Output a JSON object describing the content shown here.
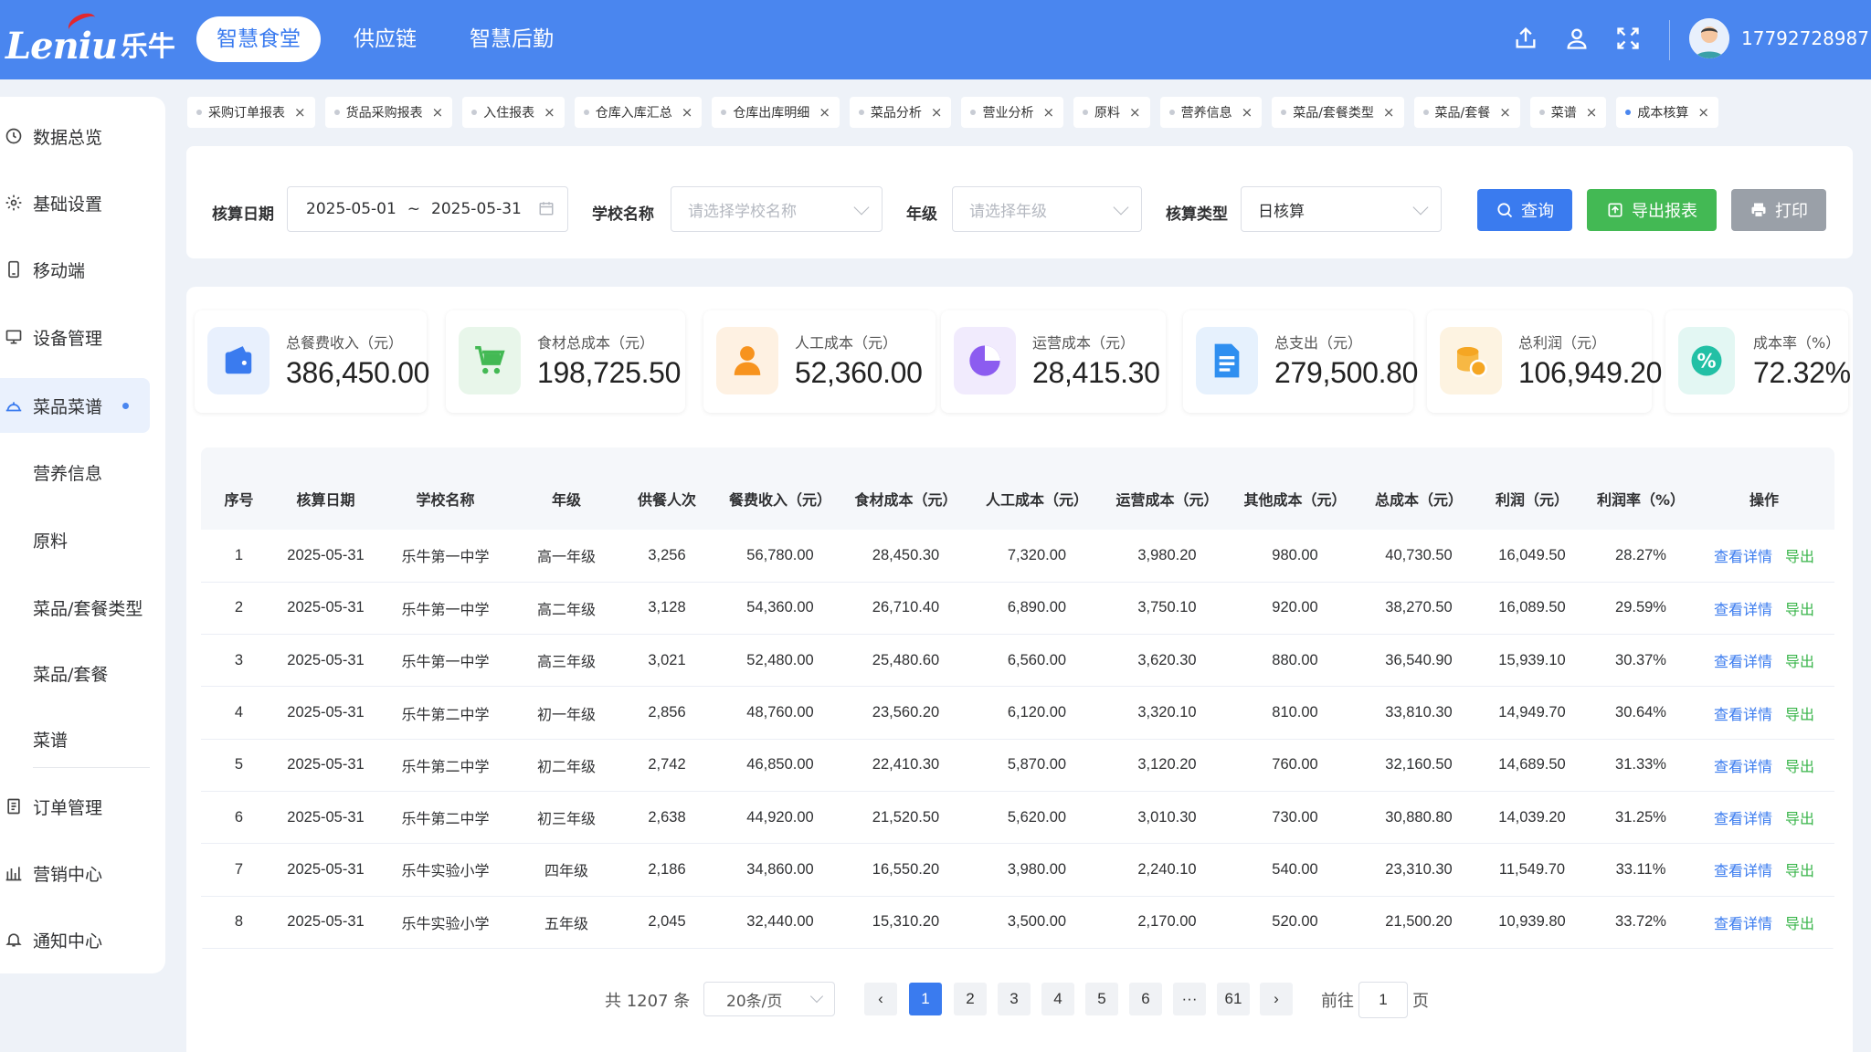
{
  "brand": {
    "en": "Leniu",
    "cn": "乐牛"
  },
  "nav": [
    {
      "label": "智慧食堂",
      "active": true
    },
    {
      "label": "供应链",
      "active": false
    },
    {
      "label": "智慧后勤",
      "active": false
    }
  ],
  "header_icons": [
    "share-icon",
    "user-icon",
    "fullscreen-icon"
  ],
  "user": {
    "phone": "17792728987"
  },
  "sidebar": [
    {
      "label": "数据总览",
      "icon": "clock-icon"
    },
    {
      "label": "基础设置",
      "icon": "gear-icon"
    },
    {
      "label": "移动端",
      "icon": "mobile-icon"
    },
    {
      "label": "设备管理",
      "icon": "monitor-icon"
    },
    {
      "label": "菜品菜谱",
      "icon": "dish-icon",
      "active": true
    },
    {
      "label": "营养信息",
      "sub": true
    },
    {
      "label": "原料",
      "sub": true
    },
    {
      "label": "菜品/套餐类型",
      "sub": true
    },
    {
      "label": "菜品/套餐",
      "sub": true
    },
    {
      "label": "菜谱",
      "sub": true
    },
    {
      "label": "订单管理",
      "icon": "order-icon"
    },
    {
      "label": "营销中心",
      "icon": "bar-chart-icon"
    },
    {
      "label": "通知中心",
      "icon": "bell-icon"
    }
  ],
  "tabs": [
    "采购订单报表",
    "货品采购报表",
    "入住报表",
    "仓库入库汇总",
    "仓库出库明细",
    "菜品分析",
    "营业分析",
    "原料",
    "营养信息",
    "菜品/套餐类型",
    "菜品/套餐",
    "菜谱",
    "成本核算"
  ],
  "active_tab": "成本核算",
  "filters": {
    "date_label": "核算日期",
    "date_start": "2025-05-01",
    "date_sep": "~",
    "date_end": "2025-05-31",
    "school_label": "学校名称",
    "school_placeholder": "请选择学校名称",
    "grade_label": "年级",
    "grade_placeholder": "请选择年级",
    "type_label": "核算类型",
    "type_value": "日核算",
    "query_btn": "查询",
    "export_btn": "导出报表",
    "print_btn": "打印"
  },
  "colors": {
    "primary": "#3a7bef",
    "success": "#43b954",
    "gray": "#9aa0a8",
    "header": "#4a86ef"
  },
  "stats": [
    {
      "label": "总餐费收入（元）",
      "value": "386,450.00",
      "icon": "wallet-icon",
      "color": "#3a7bef"
    },
    {
      "label": "食材总成本（元）",
      "value": "198,725.50",
      "icon": "cart-icon",
      "color": "#43b954"
    },
    {
      "label": "人工成本（元）",
      "value": "52,360.00",
      "icon": "person-icon",
      "color": "#f7931e"
    },
    {
      "label": "运营成本（元）",
      "value": "28,415.30",
      "icon": "pie-icon",
      "color": "#8c5cf0"
    },
    {
      "label": "总支出（元）",
      "value": "279,500.80",
      "icon": "document-icon",
      "color": "#2f8ff0"
    },
    {
      "label": "总利润（元）",
      "value": "106,949.20",
      "icon": "coins-icon",
      "color": "#f5a623"
    },
    {
      "label": "成本率（%）",
      "value": "72.32%",
      "icon": "percent-icon",
      "color": "#22c0a5"
    }
  ],
  "table": {
    "columns": [
      "序号",
      "核算日期",
      "学校名称",
      "年级",
      "供餐人次",
      "餐费收入（元）",
      "食材成本（元）",
      "人工成本（元）",
      "运营成本（元）",
      "其他成本（元）",
      "总成本（元）",
      "利润（元）",
      "利润率（%）",
      "操作"
    ],
    "view_label": "查看详情",
    "export_label": "导出",
    "rows": [
      [
        "1",
        "2025-05-31",
        "乐牛第一中学",
        "高一年级",
        "3,256",
        "56,780.00",
        "28,450.30",
        "7,320.00",
        "3,980.20",
        "980.00",
        "40,730.50",
        "16,049.50",
        "28.27%"
      ],
      [
        "2",
        "2025-05-31",
        "乐牛第一中学",
        "高二年级",
        "3,128",
        "54,360.00",
        "26,710.40",
        "6,890.00",
        "3,750.10",
        "920.00",
        "38,270.50",
        "16,089.50",
        "29.59%"
      ],
      [
        "3",
        "2025-05-31",
        "乐牛第一中学",
        "高三年级",
        "3,021",
        "52,480.00",
        "25,480.60",
        "6,560.00",
        "3,620.30",
        "880.00",
        "36,540.90",
        "15,939.10",
        "30.37%"
      ],
      [
        "4",
        "2025-05-31",
        "乐牛第二中学",
        "初一年级",
        "2,856",
        "48,760.00",
        "23,560.20",
        "6,120.00",
        "3,320.10",
        "810.00",
        "33,810.30",
        "14,949.70",
        "30.64%"
      ],
      [
        "5",
        "2025-05-31",
        "乐牛第二中学",
        "初二年级",
        "2,742",
        "46,850.00",
        "22,410.30",
        "5,870.00",
        "3,120.20",
        "760.00",
        "32,160.50",
        "14,689.50",
        "31.33%"
      ],
      [
        "6",
        "2025-05-31",
        "乐牛第二中学",
        "初三年级",
        "2,638",
        "44,920.00",
        "21,520.50",
        "5,620.00",
        "3,010.30",
        "730.00",
        "30,880.80",
        "14,039.20",
        "31.25%"
      ],
      [
        "7",
        "2025-05-31",
        "乐牛实验小学",
        "四年级",
        "2,186",
        "34,860.00",
        "16,550.20",
        "3,980.00",
        "2,240.10",
        "540.00",
        "23,310.30",
        "11,549.70",
        "33.11%"
      ],
      [
        "8",
        "2025-05-31",
        "乐牛实验小学",
        "五年级",
        "2,045",
        "32,440.00",
        "15,310.20",
        "3,500.00",
        "2,170.00",
        "520.00",
        "21,500.20",
        "10,939.80",
        "33.72%"
      ]
    ]
  },
  "pagination": {
    "total": "共 1207 条",
    "page_size": "20条/页",
    "prev": "‹",
    "pages": [
      "1",
      "2",
      "3",
      "4",
      "5",
      "6",
      "···",
      "61"
    ],
    "next": "›",
    "current": "1",
    "goto_label": "前往",
    "goto_value": "1",
    "goto_unit": "页"
  }
}
